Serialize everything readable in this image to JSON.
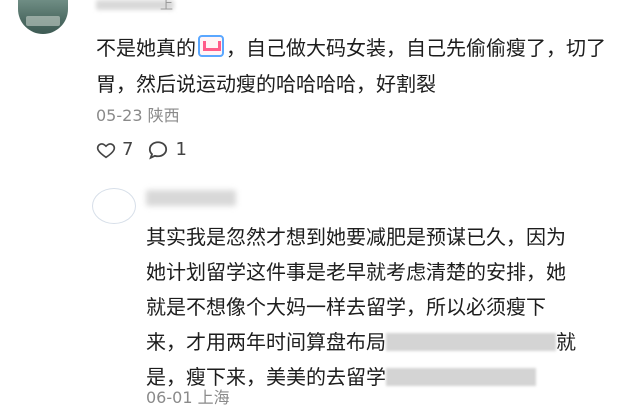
{
  "comment": {
    "author_tail": "上",
    "text_before_emoji": "不是她真的",
    "text_after_emoji": "，自己做大码女装，自己先偷偷瘦了，切了胃，然后说运动瘦的哈哈哈哈，好割裂",
    "date": "05-23",
    "location": "陕西",
    "likes": "7",
    "replies": "1"
  },
  "reply": {
    "line1": "其实我是忽然才想到她要减肥是预谋已久，因为",
    "line2": "她计划留学这件事是老早就考虑清楚的安排，她",
    "line3": "就是不想像个大妈一样去留学，所以必须瘦下",
    "line4_start": "来，才用两年时间算盘布局",
    "line4_end": "就",
    "line5_start": "是，瘦下来，美美的去留学",
    "date": "06-01",
    "location": "上海"
  }
}
